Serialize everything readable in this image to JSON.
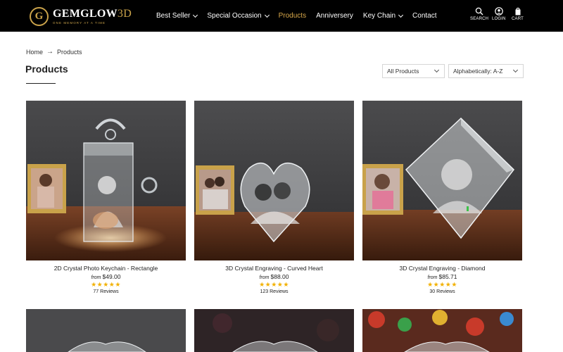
{
  "brand": {
    "logo_letter": "G",
    "name": "GEMGLOW",
    "name_accent": "3D",
    "tagline": "ONE MEMORY AT A TIME"
  },
  "nav": {
    "items": [
      {
        "label": "Best Seller",
        "has_dropdown": true
      },
      {
        "label": "Special Occasion",
        "has_dropdown": true
      },
      {
        "label": "Products",
        "active": true
      },
      {
        "label": "Anniversery"
      },
      {
        "label": "Key Chain",
        "has_dropdown": true
      },
      {
        "label": "Contact"
      }
    ],
    "active_color": "#d8a84a"
  },
  "utility": {
    "search": {
      "label": "SEARCH",
      "icon": "search-icon"
    },
    "login": {
      "label": "LOGIN",
      "icon": "user-icon"
    },
    "cart": {
      "label": "CART",
      "icon": "bag-icon"
    }
  },
  "breadcrumb": {
    "home": "Home",
    "current": "Products"
  },
  "page": {
    "title": "Products"
  },
  "filters": {
    "collection": {
      "selected": "All Products"
    },
    "sort": {
      "selected": "Alphabetically: A-Z"
    }
  },
  "products": [
    {
      "title": "2D Crystal Photo Keychain - Rectangle",
      "from_label": "from",
      "price": "$49.00",
      "rating": 5,
      "stars": "★★★★★",
      "reviews": "77 Reviews"
    },
    {
      "title": "3D Crystal Engraving - Curved Heart",
      "from_label": "from",
      "price": "$88.00",
      "rating": 5,
      "stars": "★★★★★",
      "reviews": "123 Reviews"
    },
    {
      "title": "3D Crystal Engraving - Diamond",
      "from_label": "from",
      "price": "$85.71",
      "rating": 5,
      "stars": "★★★★★",
      "reviews": "30 Reviews"
    }
  ],
  "colors": {
    "header_bg": "#000000",
    "brand_gold": "#c9a24a",
    "star": "#f2b100"
  }
}
